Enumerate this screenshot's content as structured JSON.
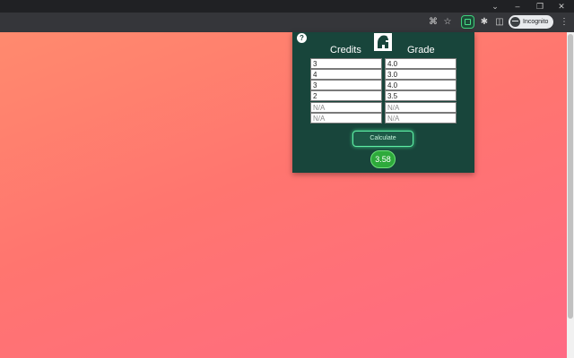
{
  "browser": {
    "incognito_label": "Incognito"
  },
  "popup": {
    "help_label": "?",
    "credits_header": "Credits",
    "grade_header": "Grade",
    "rows": [
      {
        "credits": "3",
        "grade": "4.0"
      },
      {
        "credits": "4",
        "grade": "3.0"
      },
      {
        "credits": "3",
        "grade": "4.0"
      },
      {
        "credits": "2",
        "grade": "3.5"
      },
      {
        "credits": "",
        "grade": ""
      },
      {
        "credits": "",
        "grade": ""
      }
    ],
    "placeholder": "N/A",
    "calculate_label": "Calculate",
    "result": "3.58"
  },
  "colors": {
    "popup_bg": "#18453b",
    "accent_green": "#2eaa3b"
  },
  "icons": [
    "help-icon",
    "spartan-helmet-logo-icon",
    "chevron-down-icon",
    "minimize-icon",
    "restore-icon",
    "close-icon",
    "screen-cast-icon",
    "star-icon",
    "extension-active-icon",
    "puzzle-icon",
    "side-panel-icon",
    "incognito-icon",
    "more-vert-icon"
  ]
}
